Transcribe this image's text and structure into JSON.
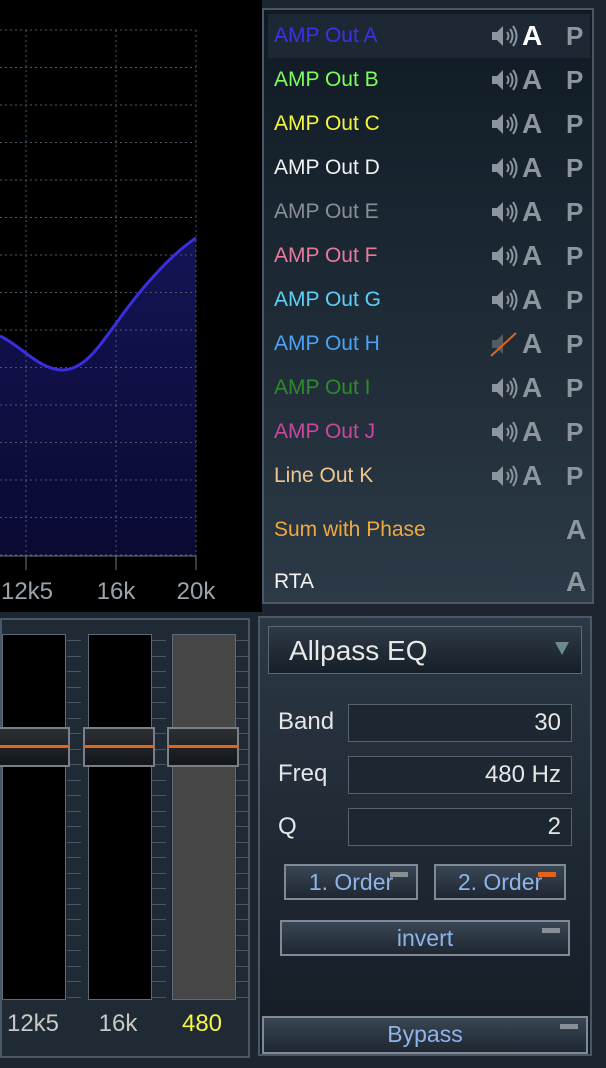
{
  "graph": {
    "x_ticks": [
      "12k5",
      "16k",
      "20k"
    ],
    "curve_color": "#3a2fe0"
  },
  "channels": [
    {
      "label": "AMP Out A",
      "color": "#3a32e8",
      "muted": false,
      "a_active": true
    },
    {
      "label": "AMP Out B",
      "color": "#7cff5c",
      "muted": false,
      "a_active": false
    },
    {
      "label": "AMP Out C",
      "color": "#f5f542",
      "muted": false,
      "a_active": false
    },
    {
      "label": "AMP Out D",
      "color": "#f2f2f2",
      "muted": false,
      "a_active": false
    },
    {
      "label": "AMP Out E",
      "color": "#8a8f94",
      "muted": false,
      "a_active": false
    },
    {
      "label": "AMP Out F",
      "color": "#e87a9a",
      "muted": false,
      "a_active": false
    },
    {
      "label": "AMP Out G",
      "color": "#5fd0f5",
      "muted": false,
      "a_active": false
    },
    {
      "label": "AMP Out H",
      "color": "#4aa3f5",
      "muted": true,
      "a_active": false
    },
    {
      "label": "AMP Out I",
      "color": "#2e8a2a",
      "muted": false,
      "a_active": false
    },
    {
      "label": "AMP Out J",
      "color": "#c9489e",
      "muted": false,
      "a_active": false
    },
    {
      "label": "Line Out K",
      "color": "#f0c48e",
      "muted": false,
      "a_active": false
    }
  ],
  "sum_with_phase": {
    "label": "Sum with Phase",
    "color": "#f0a840"
  },
  "rta": {
    "label": "RTA",
    "color": "#f2f2f2"
  },
  "icons": {
    "a": "A",
    "p": "P"
  },
  "sliders": [
    {
      "label": "12k5",
      "color": "#c8c8c8",
      "active": false
    },
    {
      "label": "16k",
      "color": "#c8c8c8",
      "active": false
    },
    {
      "label": "480",
      "color": "#f5f542",
      "active": true
    }
  ],
  "eq": {
    "type_selected": "Allpass EQ",
    "band_label": "Band",
    "band_value": "30",
    "freq_label": "Freq",
    "freq_value": "480 Hz",
    "q_label": "Q",
    "q_value": "2",
    "order1_label": "1. Order",
    "order1_active": false,
    "order2_label": "2. Order",
    "order2_active": true,
    "invert_label": "invert",
    "invert_active": false,
    "bypass_label": "Bypass",
    "bypass_active": false
  },
  "accent_color": "#e0651a"
}
